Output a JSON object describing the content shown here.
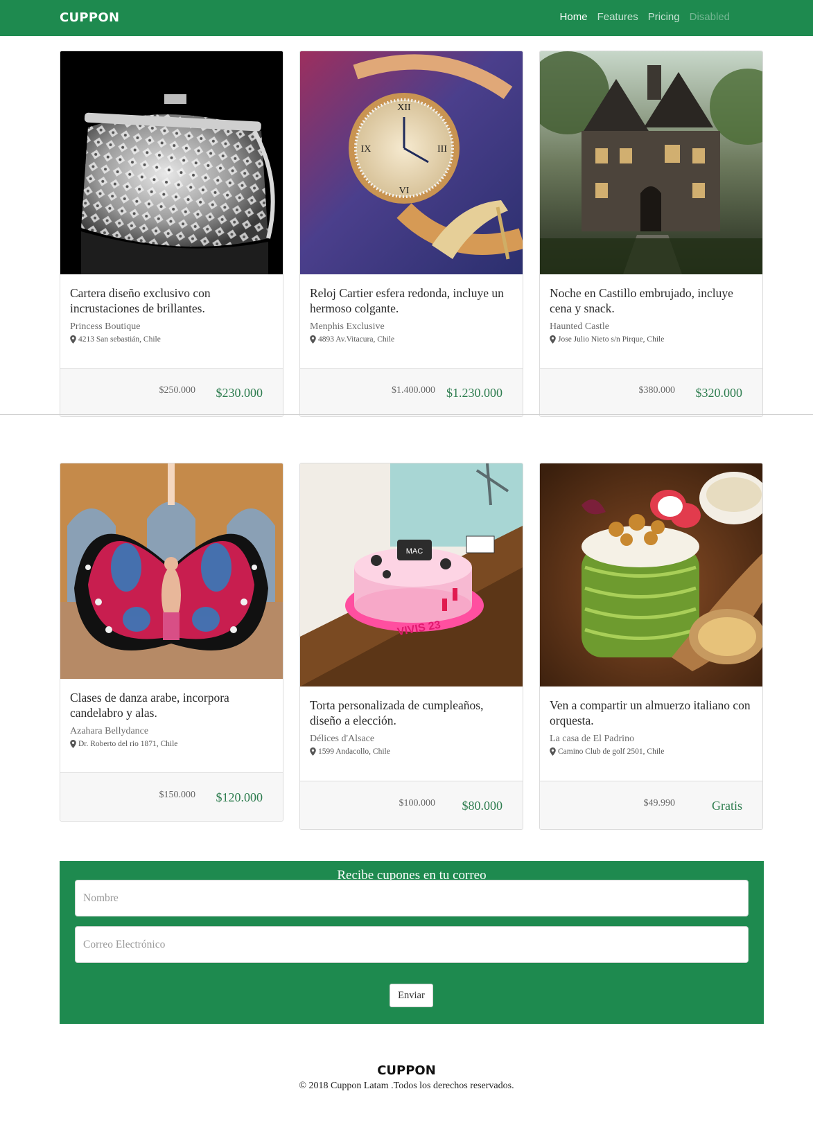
{
  "navbar": {
    "brand": "CUPPON",
    "links": [
      {
        "label": "Home"
      },
      {
        "label": "Features"
      },
      {
        "label": "Pricing"
      },
      {
        "label": "Disabled"
      }
    ]
  },
  "cards": [
    {
      "title": "Cartera diseño exclusivo con incrustaciones de brillantes.",
      "vendor": "Princess Boutique",
      "address": "4213 San sebastián, Chile",
      "price_old": "$250.000",
      "price_new": "$230.000",
      "image": "silver-clutch-bag-image"
    },
    {
      "title": "Reloj Cartier esfera redonda, incluye un hermoso colgante.",
      "vendor": "Menphis Exclusive",
      "address": "4893 Av.Vitacura, Chile",
      "price_old": "$1.400.000",
      "price_new": "$1.230.000",
      "image": "gold-watch-image"
    },
    {
      "title": "Noche en Castillo embrujado, incluye cena y snack.",
      "vendor": "Haunted Castle",
      "address": "Jose Julio Nieto s/n Pirque, Chile",
      "price_old": "$380.000",
      "price_new": "$320.000",
      "image": "haunted-castle-image"
    },
    {
      "title": "Clases de danza arabe, incorpora candelabro y alas.",
      "vendor": "Azahara Bellydance",
      "address": "Dr. Roberto del rio 1871, Chile",
      "price_old": "$150.000",
      "price_new": "$120.000",
      "image": "belly-dancers-image"
    },
    {
      "title": "Torta personalizada de cumpleaños, diseño a elección.",
      "vendor": "Délices d'Alsace",
      "address": "1599 Andacollo, Chile",
      "price_old": "$100.000",
      "price_new": "$80.000",
      "image": "birthday-cake-image"
    },
    {
      "title": "Ven a compartir un almuerzo italiano con orquesta.",
      "vendor": "La casa de El Padrino",
      "address": "Camino Club de golf 2501, Chile",
      "price_old": "$49.990",
      "price_new": "Gratis",
      "image": "italian-dish-image"
    }
  ],
  "newsletter": {
    "title": "Recibe cupones en tu correo",
    "name_placeholder": "Nombre",
    "email_placeholder": "Correo Electrónico",
    "submit_label": "Enviar"
  },
  "footer": {
    "brand": "CUPPON",
    "copyright": "© 2018 Cuppon Latam .Todos los derechos reservados."
  },
  "colors": {
    "primary_green": "#1e8a4f",
    "price_green": "#2e7d4f"
  }
}
